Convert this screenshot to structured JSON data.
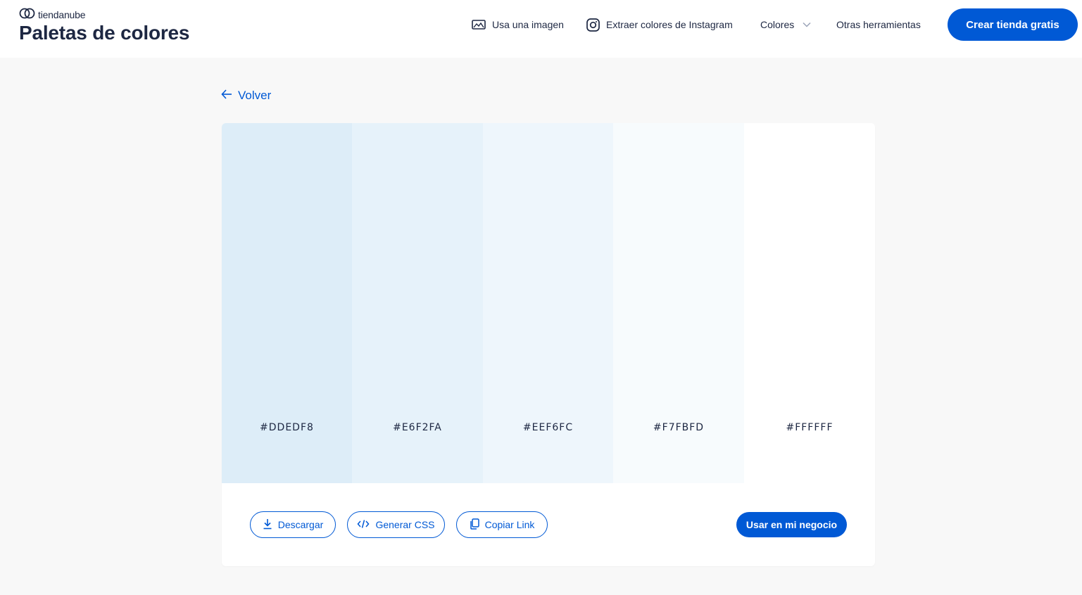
{
  "header": {
    "logo_text": "tiendanube",
    "title": "Paletas de colores",
    "nav": {
      "use_image": "Usa una imagen",
      "instagram": "Extraer colores de Instagram",
      "colors": "Colores",
      "other_tools": "Otras herramientas"
    },
    "cta_label": "Crear tienda gratis"
  },
  "back_label": "Volver",
  "palette": [
    {
      "hex": "#DDEDF8",
      "color": "#DDEDF8"
    },
    {
      "hex": "#E6F2FA",
      "color": "#E6F2FA"
    },
    {
      "hex": "#EEF6FC",
      "color": "#EEF6FC"
    },
    {
      "hex": "#F7FBFD",
      "color": "#F7FBFD"
    },
    {
      "hex": "#FFFFFF",
      "color": "#FFFFFF"
    }
  ],
  "actions": {
    "download": "Descargar",
    "generate_css": "Generar CSS",
    "copy_link": "Copiar Link",
    "use_in_business": "Usar en mi negocio"
  },
  "colors": {
    "brand_blue": "#0059d5",
    "text_dark": "#1d2742",
    "page_bg": "#f8f8f8"
  }
}
